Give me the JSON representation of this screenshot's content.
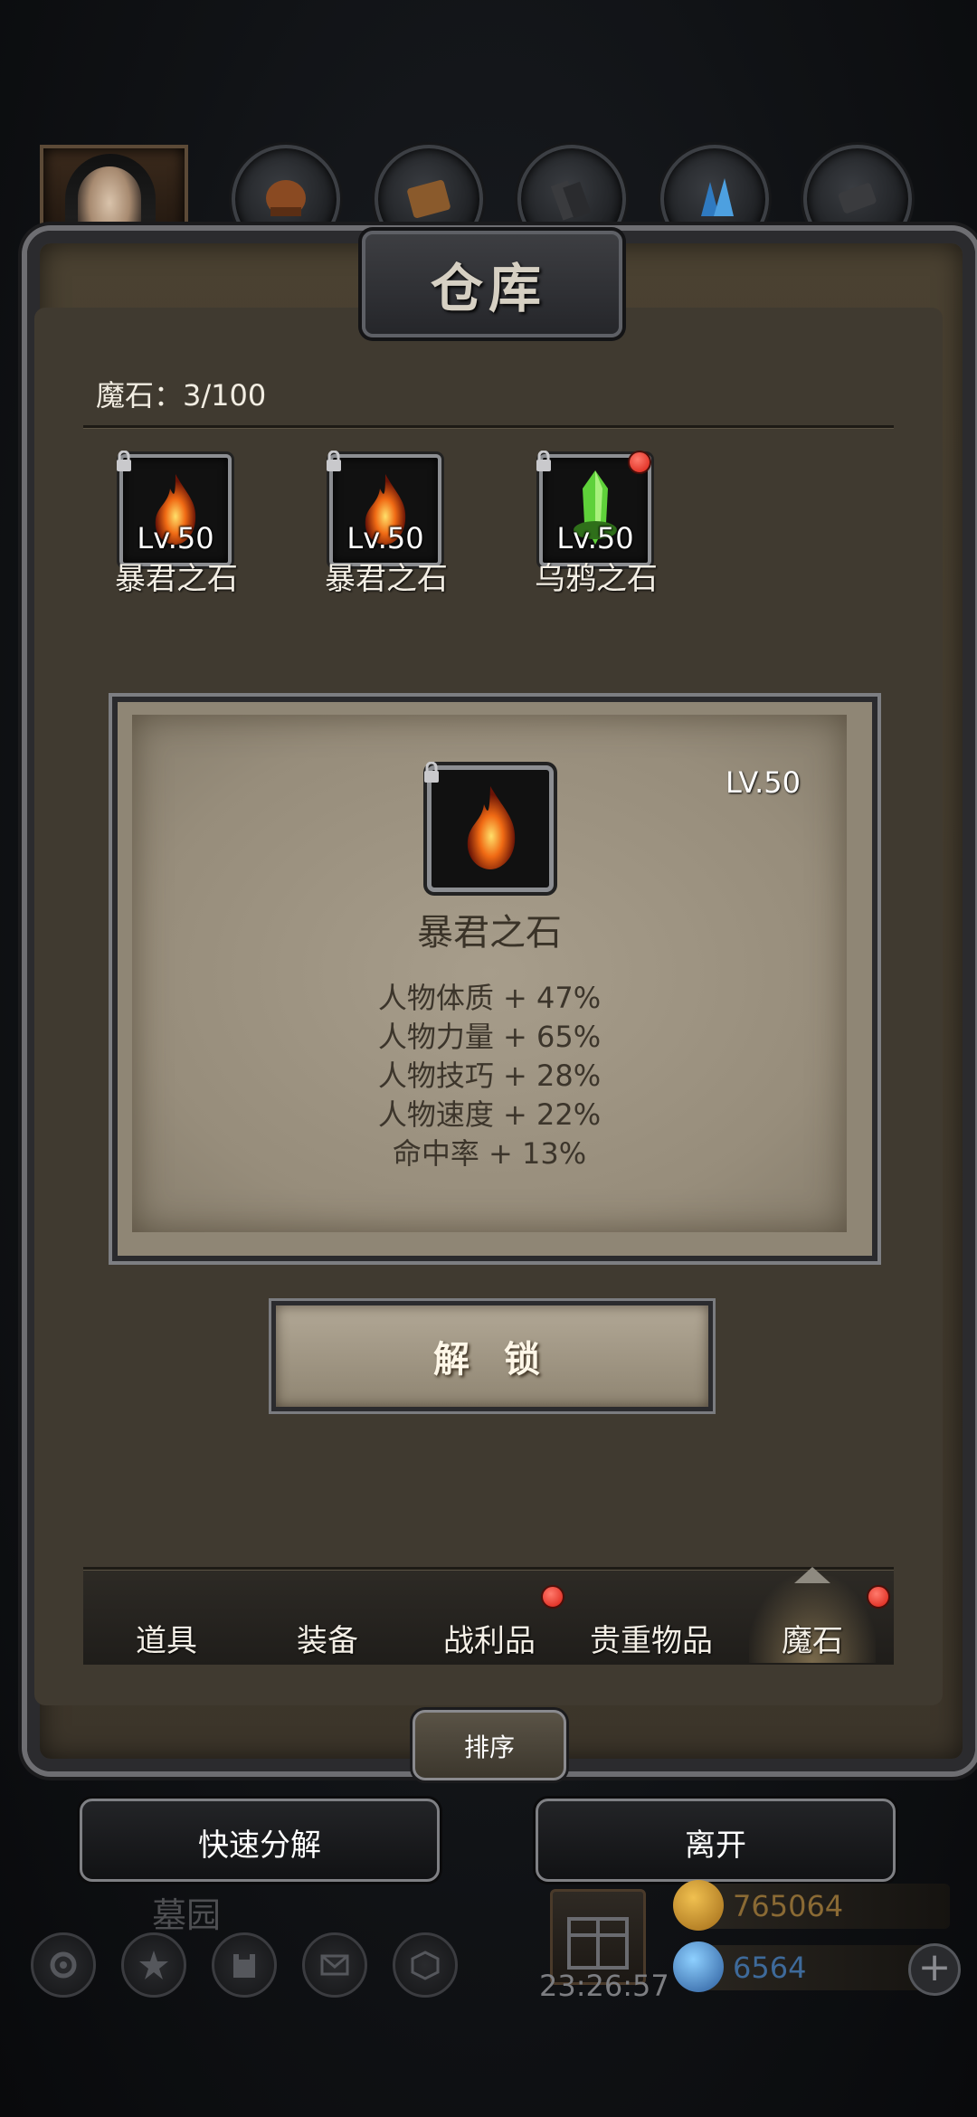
{
  "header": {
    "title": "仓库"
  },
  "top_tabs": [
    {
      "name": "character-portrait"
    },
    {
      "name": "hat-icon"
    },
    {
      "name": "armor-icon"
    },
    {
      "name": "boots-icon"
    },
    {
      "name": "crystal-icon"
    },
    {
      "name": "ring-icon"
    }
  ],
  "inventory": {
    "count_label": "魔石：3/100",
    "stones": [
      {
        "level": "Lv.50",
        "name": "暴君之石",
        "locked": true,
        "new": false
      },
      {
        "level": "Lv.50",
        "name": "暴君之石",
        "locked": true,
        "new": false
      },
      {
        "level": "Lv.50",
        "name": "乌鸦之石",
        "locked": true,
        "new": true
      }
    ]
  },
  "detail": {
    "level": "LV.50",
    "name": "暴君之石",
    "stats": [
      "人物体质 + 47%",
      "人物力量 + 65%",
      "人物技巧 + 28%",
      "人物速度 + 22%",
      "命中率 + 13%"
    ],
    "unlock_label": "解 锁"
  },
  "bottom_tabs": [
    {
      "label": "道具",
      "badge": false,
      "active": false
    },
    {
      "label": "装备",
      "badge": false,
      "active": false
    },
    {
      "label": "战利品",
      "badge": true,
      "active": false
    },
    {
      "label": "贵重物品",
      "badge": false,
      "active": false
    },
    {
      "label": "魔石",
      "badge": true,
      "active": true
    }
  ],
  "sort_label": "排序",
  "actions": {
    "quick_decompose": "快速分解",
    "leave": "离开"
  },
  "hud": {
    "area_name": "墓园",
    "timer": "23:26:57",
    "gold": "765064",
    "gems": "6564"
  },
  "colors": {
    "gold": "#b88a3a",
    "gems": "#4a7fb8",
    "badge": "#e0281c"
  }
}
